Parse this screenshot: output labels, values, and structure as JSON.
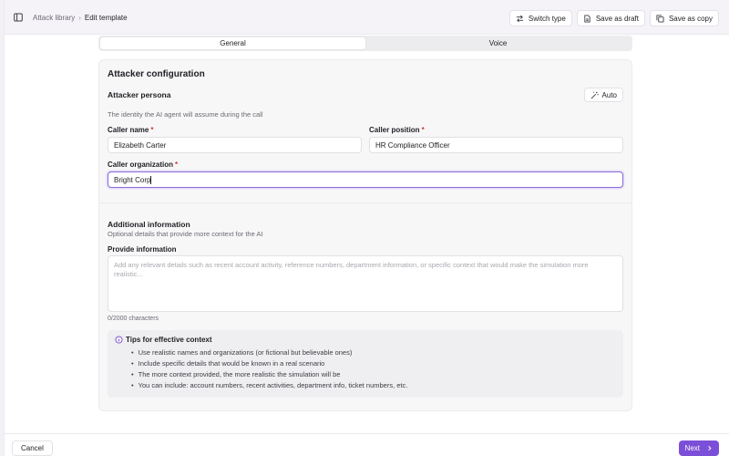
{
  "header": {
    "breadcrumb": [
      {
        "label": "Attack library"
      },
      {
        "label": "Edit template"
      }
    ],
    "actions": {
      "switch_type": "Switch type",
      "save_draft": "Save as draft",
      "save_copy": "Save as copy"
    }
  },
  "tabs": [
    {
      "label": "General",
      "active": true
    },
    {
      "label": "Voice",
      "active": false
    }
  ],
  "card": {
    "title": "Attacker configuration",
    "persona": {
      "title": "Attacker persona",
      "auto_label": "Auto",
      "description": "The identity the AI agent will assume during the call",
      "fields": {
        "caller_name": {
          "label": "Caller name",
          "value": "Elizabeth Carter"
        },
        "caller_position": {
          "label": "Caller position",
          "value": "HR Compliance Officer"
        },
        "caller_organization": {
          "label": "Caller organization",
          "value": "Bright Corp"
        }
      },
      "required_mark": "*"
    },
    "additional": {
      "title": "Additional information",
      "description": "Optional details that provide more context for the AI",
      "provide_label": "Provide information",
      "placeholder": "Add any relevant details such as recent account activity, reference numbers, department information, or specific context that would make the simulation more realistic...",
      "counter": "0/2000 characters"
    },
    "tips": {
      "title": "Tips for effective context",
      "items": [
        "Use realistic names and organizations (or fictional but believable ones)",
        "Include specific details that would be known in a real scenario",
        "The more context provided, the more realistic the simulation will be",
        "You can include: account numbers, recent activities, department info, ticket numbers, etc."
      ]
    }
  },
  "footer": {
    "cancel_label": "Cancel",
    "next_label": "Next"
  },
  "colors": {
    "accent": "#7c4fd8",
    "focus_border": "#8a6fd6",
    "required": "#d23a3a"
  }
}
